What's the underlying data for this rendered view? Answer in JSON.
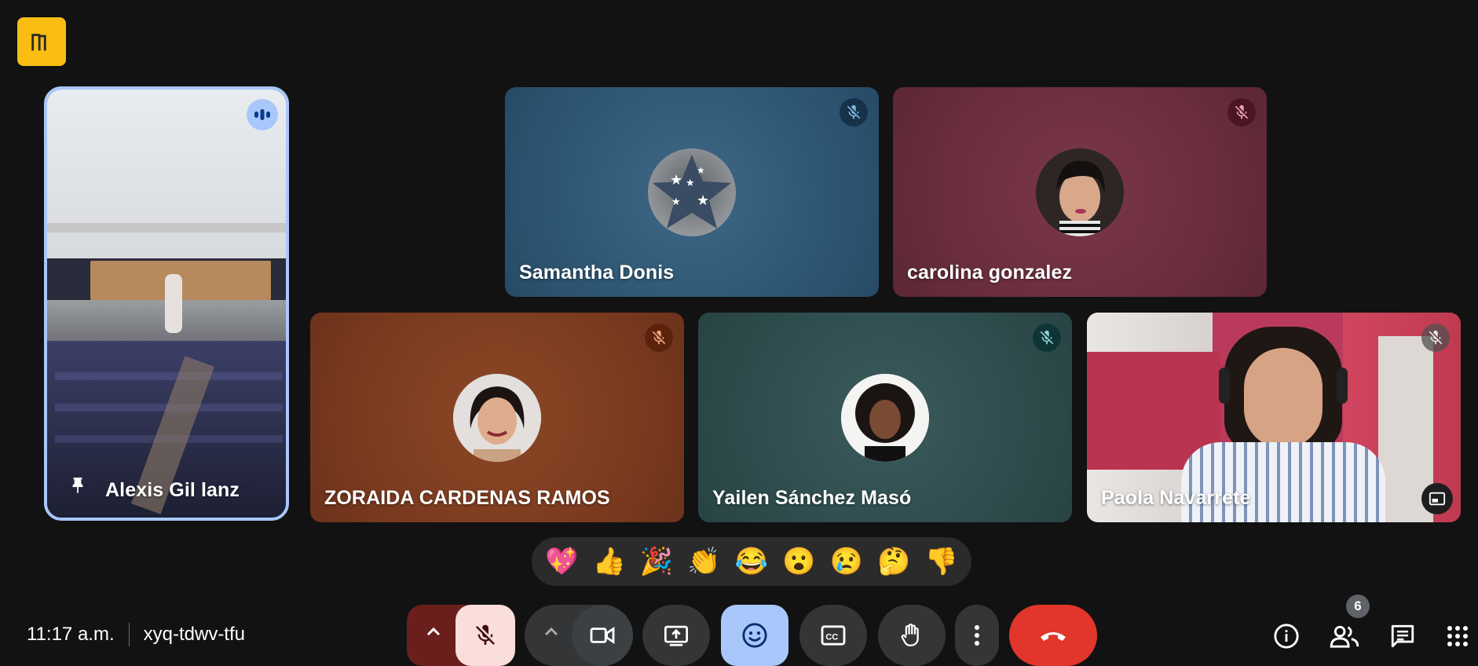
{
  "meeting": {
    "time": "11:17 a.m.",
    "code": "xyq-tdwv-tfu",
    "participant_count": "6"
  },
  "participants": [
    {
      "name": "Alexis Gil lanz",
      "pinned": true,
      "speaking": true,
      "video": true
    },
    {
      "name": "Samantha Donis",
      "muted": true,
      "tile_color": "#2e5774"
    },
    {
      "name": "carolina gonzalez",
      "muted": true,
      "tile_color": "#6b2e3e"
    },
    {
      "name": "ZORAIDA CARDENAS RAMOS",
      "muted": true,
      "tile_color": "#7c3b1f"
    },
    {
      "name": "Yailen Sánchez Masó",
      "muted": true,
      "tile_color": "#2f4d4e"
    },
    {
      "name": "Paola Navarrete",
      "muted": true,
      "video": true
    }
  ],
  "reactions": [
    "💖",
    "👍",
    "🎉",
    "👏",
    "😂",
    "😮",
    "😢",
    "🤔",
    "👎"
  ],
  "colors": {
    "accent_yellow": "#f9bd13",
    "end_call_red": "#e2352b",
    "active_blue": "#a8c7fa",
    "mic_off_bg": "#f9dedc"
  },
  "icons": {
    "mic": "mic-off-icon",
    "camera": "videocam-icon",
    "present": "present-screen-icon",
    "emoji": "emoji-icon",
    "captions": "captions-icon",
    "hand": "raise-hand-icon",
    "more": "more-vert-icon",
    "end": "call-end-icon",
    "info": "info-icon",
    "people": "people-icon",
    "chat": "chat-icon",
    "activities": "apps-grid-icon"
  }
}
